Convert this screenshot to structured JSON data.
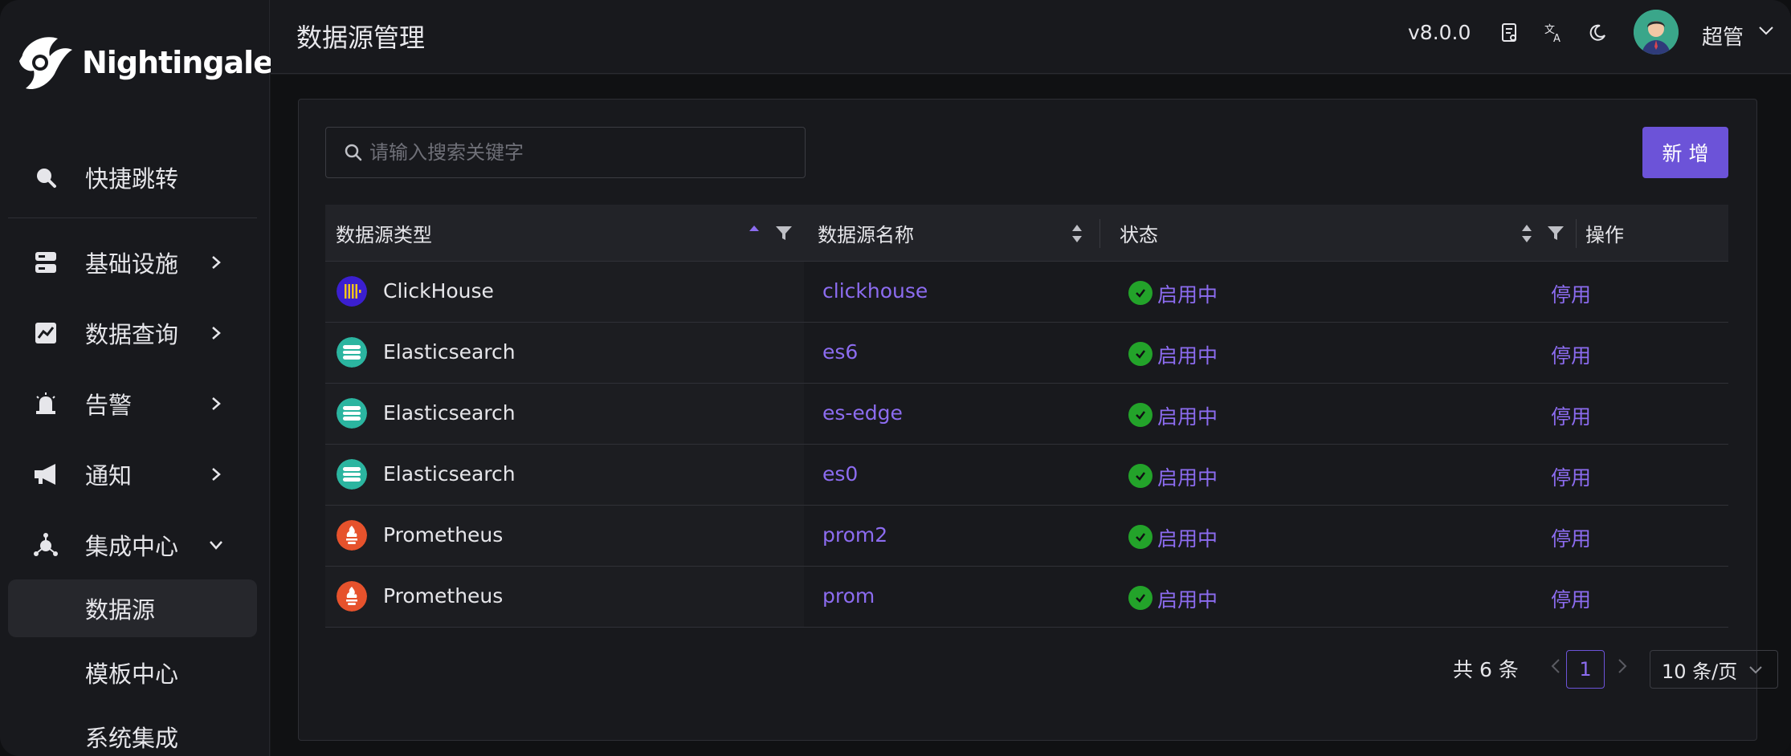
{
  "app": {
    "name": "Nightingale"
  },
  "sidebar": {
    "items": [
      {
        "label": "快捷跳转",
        "icon": "search-icon"
      },
      {
        "label": "基础设施",
        "icon": "server-icon"
      },
      {
        "label": "数据查询",
        "icon": "chart-line-icon"
      },
      {
        "label": "告警",
        "icon": "alarm-icon"
      },
      {
        "label": "通知",
        "icon": "megaphone-icon"
      },
      {
        "label": "集成中心",
        "icon": "integration-icon"
      }
    ],
    "sub_items": [
      {
        "label": "数据源",
        "active": true
      },
      {
        "label": "模板中心"
      },
      {
        "label": "系统集成"
      }
    ]
  },
  "header": {
    "title": "数据源管理",
    "version": "v8.0.0",
    "user_name": "超管"
  },
  "toolbar": {
    "search_placeholder": "请输入搜索关键字",
    "add_label": "新 增"
  },
  "table": {
    "columns": [
      "数据源类型",
      "数据源名称",
      "状态",
      "操作"
    ],
    "rows": [
      {
        "type": "ClickHouse",
        "type_icon": "clickhouse-icon",
        "name": "clickhouse",
        "status": "启用中",
        "action": "停用"
      },
      {
        "type": "Elasticsearch",
        "type_icon": "elasticsearch-icon",
        "name": "es6",
        "status": "启用中",
        "action": "停用"
      },
      {
        "type": "Elasticsearch",
        "type_icon": "elasticsearch-icon",
        "name": "es-edge",
        "status": "启用中",
        "action": "停用"
      },
      {
        "type": "Elasticsearch",
        "type_icon": "elasticsearch-icon",
        "name": "es0",
        "status": "启用中",
        "action": "停用"
      },
      {
        "type": "Prometheus",
        "type_icon": "prometheus-icon",
        "name": "prom2",
        "status": "启用中",
        "action": "停用"
      },
      {
        "type": "Prometheus",
        "type_icon": "prometheus-icon",
        "name": "prom",
        "status": "启用中",
        "action": "停用"
      }
    ]
  },
  "pagination": {
    "total": "共 6 条",
    "current_page": "1",
    "page_size": "10 条/页"
  },
  "colors": {
    "accent": "#6c53d8",
    "link": "#8c6cf0",
    "status_ok": "#23a32a"
  }
}
